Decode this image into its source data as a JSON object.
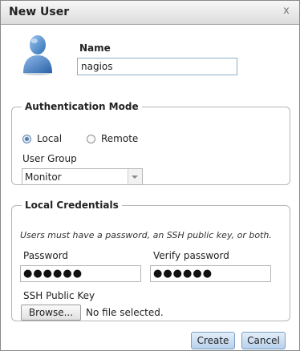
{
  "dialog": {
    "title": "New User",
    "close_symbol": "x"
  },
  "user": {
    "avatar_icon": "user-avatar-icon",
    "name_label": "Name",
    "name_value": "nagios"
  },
  "auth": {
    "legend": "Authentication Mode",
    "modes": [
      {
        "label": "Local",
        "selected": true
      },
      {
        "label": "Remote",
        "selected": false
      }
    ],
    "group_label": "User Group",
    "group_value": "Monitor"
  },
  "credentials": {
    "legend": "Local Credentials",
    "hint": "Users must have a password, an SSH public key, or both.",
    "password_label": "Password",
    "password_value": "●●●●●●",
    "verify_label": "Verify password",
    "verify_value": "●●●●●●",
    "ssh_label": "SSH Public Key",
    "browse_label": "Browse...",
    "file_status": "No file selected."
  },
  "actions": {
    "create_label": "Create",
    "cancel_label": "Cancel"
  },
  "colors": {
    "title_bar": "#dcdcdc",
    "button_blue": "#b7d0ea",
    "avatar_blue": "#4f86c6"
  }
}
